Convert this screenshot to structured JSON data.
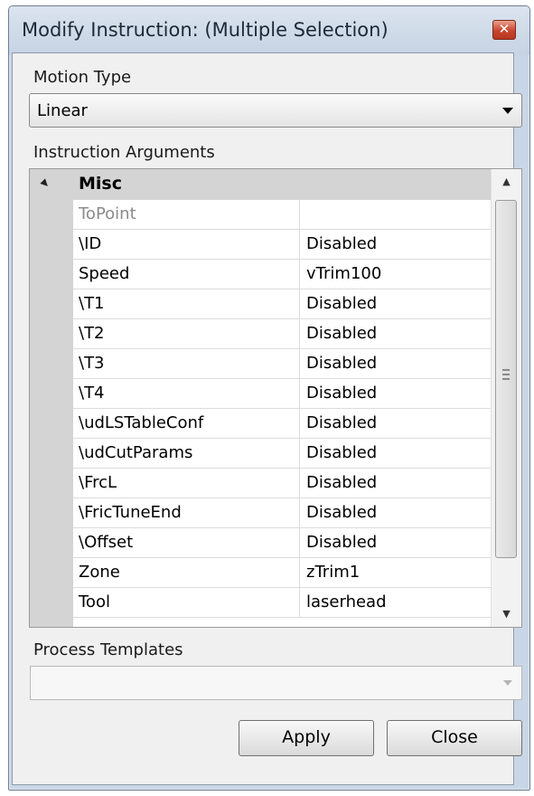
{
  "window": {
    "title": "Modify Instruction: (Multiple Selection)",
    "close_glyph": "✕"
  },
  "motion_type": {
    "label": "Motion Type",
    "value": "Linear"
  },
  "instruction_arguments": {
    "label": "Instruction Arguments",
    "category": "Misc",
    "rows": [
      {
        "name": "ToPoint",
        "value": ""
      },
      {
        "name": "\\ID",
        "value": "Disabled"
      },
      {
        "name": "Speed",
        "value": "vTrim100"
      },
      {
        "name": "\\T1",
        "value": "Disabled"
      },
      {
        "name": "\\T2",
        "value": "Disabled"
      },
      {
        "name": "\\T3",
        "value": "Disabled"
      },
      {
        "name": "\\T4",
        "value": "Disabled"
      },
      {
        "name": "\\udLSTableConf",
        "value": "Disabled"
      },
      {
        "name": "\\udCutParams",
        "value": "Disabled"
      },
      {
        "name": "\\FrcL",
        "value": "Disabled"
      },
      {
        "name": "\\FricTuneEnd",
        "value": "Disabled"
      },
      {
        "name": "\\Offset",
        "value": "Disabled"
      },
      {
        "name": "Zone",
        "value": "zTrim1"
      },
      {
        "name": "Tool",
        "value": "laserhead"
      }
    ]
  },
  "process_templates": {
    "label": "Process Templates",
    "value": ""
  },
  "buttons": {
    "apply": "Apply",
    "close": "Close"
  },
  "icons": {
    "scroll_up": "▲",
    "scroll_down": "▼"
  }
}
